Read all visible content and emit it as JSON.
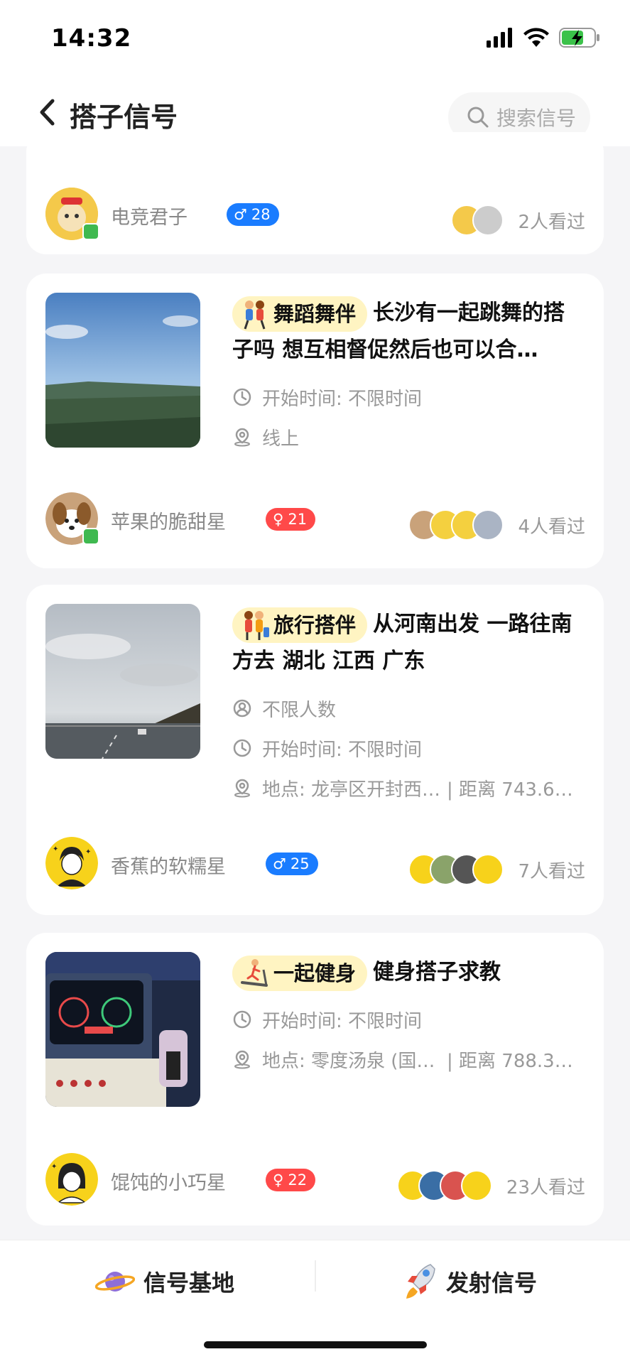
{
  "status_bar": {
    "time": "14:32"
  },
  "header": {
    "title": "搭子信号",
    "search_placeholder": "搜索信号"
  },
  "cards": [
    {
      "username": "电竞君子",
      "gender": "male",
      "age": "28",
      "views": "2人看过"
    },
    {
      "tag": "舞蹈舞伴",
      "title": "长沙有一起跳舞的搭子吗 想互相督促然后也可以合…",
      "start_time": "开始时间: 不限时间",
      "location": "线上",
      "username": "苹果的脆甜星",
      "gender": "female",
      "age": "21",
      "views": "4人看过"
    },
    {
      "tag": "旅行搭伴",
      "title": "从河南出发  一路往南方去  湖北  江西   广东",
      "people": "不限人数",
      "start_time": "开始时间: 不限时间",
      "location": "地点: 龙亭区开封西…",
      "distance": "| 距离 743.6…",
      "username": "香蕉的软糯星",
      "gender": "male",
      "age": "25",
      "views": "7人看过"
    },
    {
      "tag": "一起健身",
      "title": "健身搭子求教",
      "start_time": "开始时间: 不限时间",
      "location": "地点: 零度汤泉 (国…",
      "distance": "| 距离 788.3…",
      "username": "馄饨的小巧星",
      "gender": "female",
      "age": "22",
      "views": "23人看过"
    }
  ],
  "bottom_nav": {
    "base_label": "信号基地",
    "launch_label": "发射信号"
  },
  "colors": {
    "male_badge": "#1a7cff",
    "female_badge": "#ff4949",
    "tag_bg": "#fff4c2"
  }
}
